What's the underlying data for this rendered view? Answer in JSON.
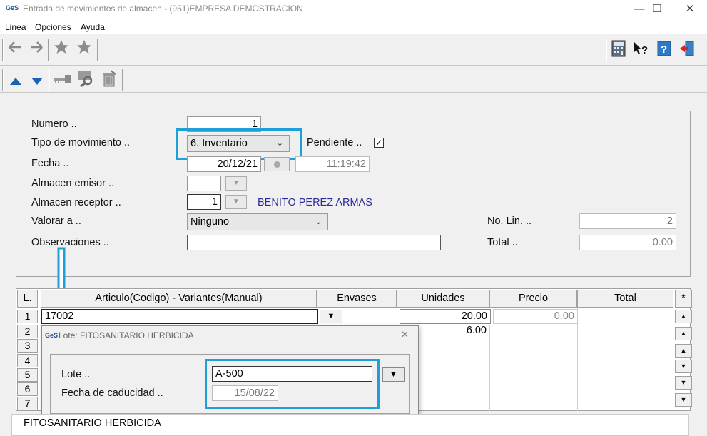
{
  "window": {
    "logo": "GeS",
    "title": "Entrada de movimientos de almacen - (951)EMPRESA DEMOSTRACION",
    "controls": {
      "minimize": "—",
      "maximize": "☐",
      "close": "✕"
    }
  },
  "menu": [
    {
      "label": "Linea"
    },
    {
      "label": "Opciones"
    },
    {
      "label": "Ayuda"
    }
  ],
  "form": {
    "numero": {
      "label": "Numero ..",
      "value": "1"
    },
    "tipo": {
      "label": "Tipo de movimiento ..",
      "value": "6. Inventario"
    },
    "pendiente": {
      "label": "Pendiente ..",
      "checked": true
    },
    "fecha": {
      "label": "Fecha ..",
      "date": "20/12/21",
      "time": "11:19:42"
    },
    "almacen_emisor": {
      "label": "Almacen emisor ..",
      "value": ""
    },
    "almacen_receptor": {
      "label": "Almacen receptor ..",
      "value": "1",
      "name": "BENITO PEREZ ARMAS"
    },
    "valorar": {
      "label": "Valorar a ..",
      "value": "Ninguno"
    },
    "observaciones": {
      "label": "Observaciones ..",
      "value": ""
    },
    "no_lin": {
      "label": "No. Lin. ..",
      "value": "2"
    },
    "total": {
      "label": "Total ..",
      "value": "0.00"
    }
  },
  "grid": {
    "headers": {
      "line": "L.",
      "articulo": "Articulo(Codigo) - Variantes(Manual)",
      "envases": "Envases",
      "unidades": "Unidades",
      "precio": "Precio",
      "total": "Total",
      "star": "*"
    },
    "rownums": [
      "1",
      "2",
      "3",
      "4",
      "5",
      "6",
      "7"
    ],
    "row1": {
      "articulo": "17002",
      "unidades": "20.00",
      "precio": "0.00"
    },
    "row2": {
      "unidades": "6.00"
    }
  },
  "dialog": {
    "logo": "GeS",
    "title": "Lote: FITOSANITARIO HERBICIDA",
    "close": "✕",
    "lote": {
      "label": "Lote ..",
      "value": "A-500"
    },
    "caducidad": {
      "label": "Fecha de caducidad ..",
      "value": "15/08/22"
    }
  },
  "status": {
    "text": "FITOSANITARIO HERBICIDA"
  },
  "colors": {
    "highlight": "#1e9fd8",
    "receptor_name": "#2b2b9c",
    "arrow": "#1e9fd8"
  }
}
